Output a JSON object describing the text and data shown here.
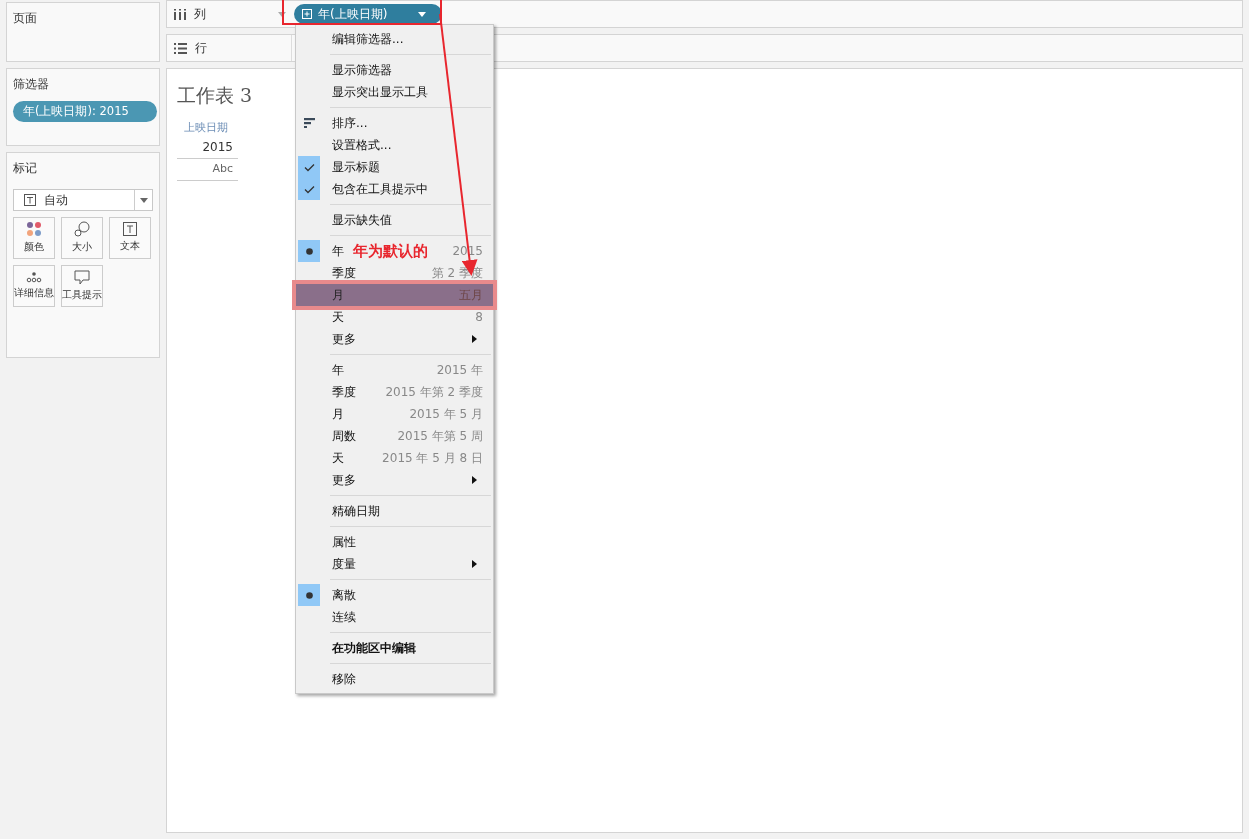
{
  "left_panel": {
    "pages_card": {
      "title": "页面"
    },
    "filters_card": {
      "title": "筛选器",
      "pills": [
        "年(上映日期): 2015"
      ]
    },
    "marks_card": {
      "title": "标记",
      "mark_type": "自动",
      "buttons": [
        {
          "label": "颜色",
          "kind": "color"
        },
        {
          "label": "大小",
          "kind": "size"
        },
        {
          "label": "文本",
          "kind": "text"
        },
        {
          "label": "详细信息",
          "kind": "detail"
        },
        {
          "label": "工具提示",
          "kind": "tooltip"
        }
      ]
    }
  },
  "shelves": [
    {
      "label": "列",
      "kind": "columns",
      "pill": "年(上映日期)"
    },
    {
      "label": "行",
      "kind": "rows"
    }
  ],
  "sheet": {
    "title": "工作表 3",
    "header": "上映日期",
    "cells": [
      "2015",
      "Abc"
    ]
  },
  "context_menu": {
    "sections": [
      [
        {
          "label": "编辑筛选器...",
          "kind": "plain"
        }
      ],
      [
        {
          "label": "显示筛选器",
          "kind": "plain"
        },
        {
          "label": "显示突出显示工具",
          "kind": "plain"
        }
      ],
      [
        {
          "label": "排序...",
          "kind": "sort"
        },
        {
          "label": "设置格式...",
          "kind": "plain"
        },
        {
          "label": "显示标题",
          "kind": "check",
          "checked": true
        },
        {
          "label": "包含在工具提示中",
          "kind": "check",
          "checked": true
        }
      ],
      [
        {
          "label": "显示缺失值",
          "kind": "plain"
        }
      ],
      [
        {
          "label": "年",
          "value": "2015",
          "kind": "radio",
          "selected": true
        },
        {
          "label": "季度",
          "value": "第 2 季度",
          "kind": "radio",
          "selected": false
        },
        {
          "label": "月",
          "value": "五月",
          "kind": "radio",
          "selected": false,
          "highlighted": true
        },
        {
          "label": "天",
          "value": "8",
          "kind": "radio",
          "selected": false
        },
        {
          "label": "更多",
          "kind": "submenu"
        }
      ],
      [
        {
          "label": "年",
          "value": "2015 年",
          "kind": "radio",
          "selected": false
        },
        {
          "label": "季度",
          "value": "2015 年第 2 季度",
          "kind": "radio",
          "selected": false
        },
        {
          "label": "月",
          "value": "2015 年 5 月",
          "kind": "radio",
          "selected": false
        },
        {
          "label": "周数",
          "value": "2015 年第 5 周",
          "kind": "radio",
          "selected": false
        },
        {
          "label": "天",
          "value": "2015 年 5 月 8 日",
          "kind": "radio",
          "selected": false
        },
        {
          "label": "更多",
          "kind": "submenu"
        }
      ],
      [
        {
          "label": "精确日期",
          "kind": "radio",
          "selected": false
        }
      ],
      [
        {
          "label": "属性",
          "kind": "plain"
        },
        {
          "label": "度量",
          "kind": "submenu"
        }
      ],
      [
        {
          "label": "离散",
          "kind": "radio",
          "selected": true
        },
        {
          "label": "连续",
          "kind": "radio",
          "selected": false
        }
      ],
      [
        {
          "label": "在功能区中编辑",
          "kind": "bold"
        }
      ],
      [
        {
          "label": "移除",
          "kind": "plain"
        }
      ]
    ]
  },
  "annotation": {
    "label": "年为默认的"
  }
}
